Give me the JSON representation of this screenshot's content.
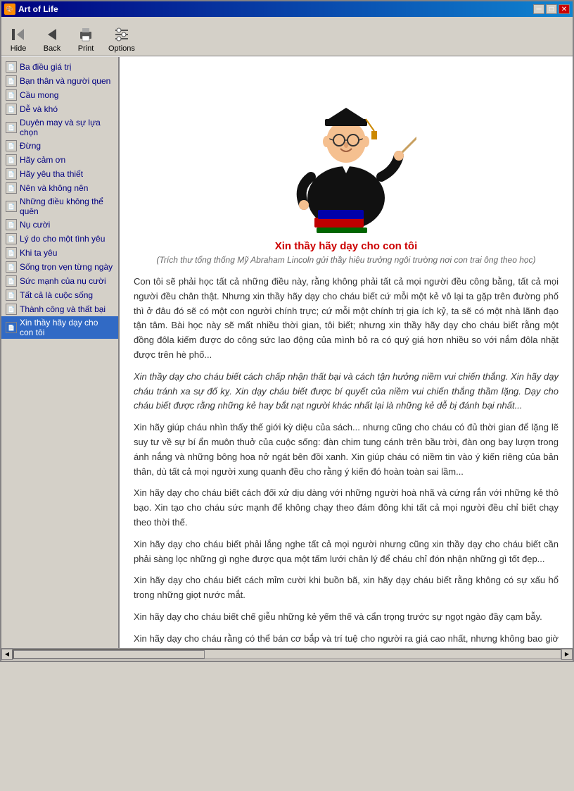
{
  "window": {
    "title": "Art of Life",
    "min_btn": "─",
    "max_btn": "□",
    "close_btn": "✕"
  },
  "toolbar": {
    "hide_label": "Hide",
    "back_label": "Back",
    "print_label": "Print",
    "options_label": "Options"
  },
  "sidebar": {
    "items": [
      {
        "label": "Ba điều giá trị"
      },
      {
        "label": "Bạn thân và người quen"
      },
      {
        "label": "Cầu mong"
      },
      {
        "label": "Dễ và khó"
      },
      {
        "label": "Duyên may và sự lựa chọn"
      },
      {
        "label": "Đừng"
      },
      {
        "label": "Hãy cảm ơn"
      },
      {
        "label": "Hãy yêu tha thiết"
      },
      {
        "label": "Nên và không nên"
      },
      {
        "label": "Những điều không thể quên"
      },
      {
        "label": "Nụ cười"
      },
      {
        "label": "Lý do cho một tình yêu"
      },
      {
        "label": "Khi ta yêu"
      },
      {
        "label": "Sống trọn vẹn từng ngày"
      },
      {
        "label": "Sức mạnh của nụ cười"
      },
      {
        "label": "Tất cả là cuộc sống"
      },
      {
        "label": "Thành công và thất bại"
      },
      {
        "label": "Xin thầy hãy dạy cho con tôi"
      }
    ]
  },
  "article": {
    "title": "Xin thầy hãy dạy cho con tôi",
    "subtitle": "(Trích thư tổng thống Mỹ Abraham Lincoln gửi thầy hiệu trưởng ngôi trường nơi con trai ông theo học)",
    "paragraphs": [
      "Con tôi sẽ phải học tất cả những điều này, rằng không phải tất cả mọi người đều công bằng, tất cả mọi người đều chân thật. Nhưng xin thầy hãy dạy cho cháu biết cứ mỗi một kẻ vô lại ta gặp trên đường phố thì ở đâu đó sẽ có một con người chính trực; cứ mỗi một chính trị gia ích kỷ, ta sẽ có một nhà lãnh đạo tận tâm. Bài học này sẽ mất nhiều thời gian, tôi biết; nhưng xin thầy hãy dạy cho cháu biết rằng một đồng đôla kiếm được do công sức lao động của mình bỏ ra có quý giá hơn nhiều so với nắm đôla nhặt được trên hè phố...",
      "Xin thầy dạy cho cháu biết cách chấp nhận thất bại và cách tận hưởng niềm vui chiến thắng. Xin hãy dạy cháu tránh xa sự đố kỵ. Xin dạy cháu biết được bí quyết của niềm vui chiến thắng thầm lặng. Dạy cho cháu biết được rằng những kẻ hay bắt nạt người khác nhất lại là những kẻ dễ bị đánh bại nhất...",
      "Xin hãy giúp cháu nhìn thấy thế giới kỳ diệu của sách... nhưng cũng cho cháu có đủ thời gian để lặng lẽ suy tư về sự bí ẩn muôn thuở của cuộc sống: đàn chim tung cánh trên bầu trời, đàn ong bay lượn trong ánh nắng và những bông hoa nở ngát bên đồi xanh. Xin giúp cháu có niềm tin vào ý kiến riêng của bản thân, dù tất cả mọi người xung quanh đều cho rằng ý kiến đó hoàn toàn sai lầm...",
      "Xin hãy dạy cho cháu biết cách đối xử dịu dàng với những người hoà nhã và cứng rắn với những kẻ thô bạo. Xin tạo cho cháu sức mạnh để không chạy theo đám đông khi tất cả mọi người đều chỉ biết chạy theo thời thế.",
      "Xin hãy dạy cho cháu biết phải lắng nghe tất cả mọi người nhưng cũng xin thầy dạy cho cháu biết cần phải sàng lọc những gì nghe được qua một tấm lưới chân lý để cháu chỉ đón nhận những gì tốt đẹp...",
      "Xin hãy dạy cho cháu biết cách mỉm cười khi buồn bã, xin hãy dạy cháu biết rằng không có sự xấu hổ trong những giọt nước mắt.",
      "Xin hãy dạy cho cháu biết chế giễu những kẻ yếm thế và cẩn trọng trước sự ngọt ngào đầy cạm bẫy.",
      "Xin hãy dạy cho cháu rằng có thể bán cơ bắp và trí tuệ cho người ra giá cao nhất, nhưng không bao giờ cho phép ai ra giá mua trái tim và tâm hồn mình."
    ]
  }
}
